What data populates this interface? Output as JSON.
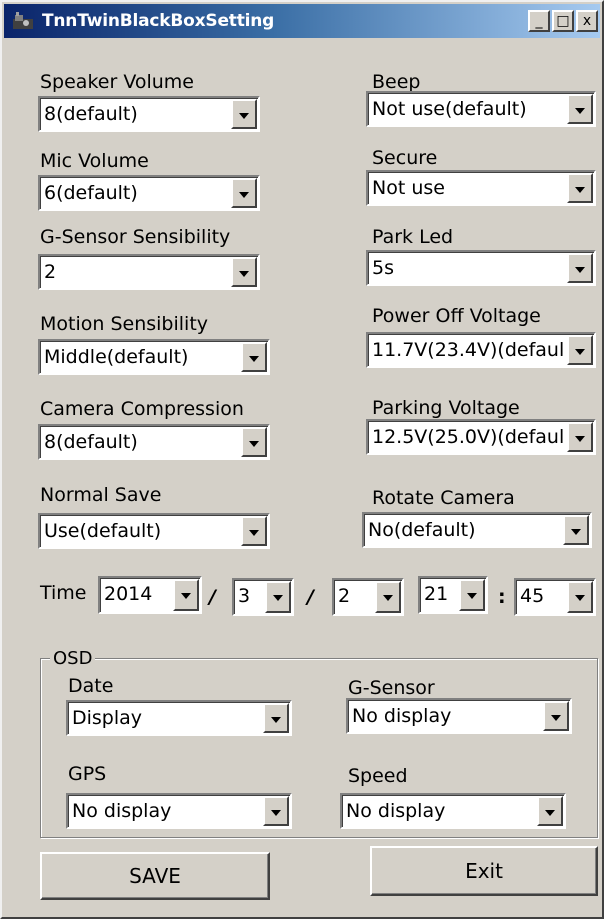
{
  "window": {
    "title": "TnnTwinBlackBoxSetting",
    "controls": [
      "_",
      "□",
      "x"
    ]
  },
  "left_settings": [
    {
      "label": "Speaker Volume",
      "value": "8(default)"
    },
    {
      "label": "Mic Volume",
      "value": "6(default)"
    },
    {
      "label": "G-Sensor Sensibility",
      "value": "2"
    },
    {
      "label": "Motion Sensibility",
      "value": "Middle(default)"
    },
    {
      "label": "Camera Compression",
      "value": "8(default)"
    },
    {
      "label": "Normal Save",
      "value": "Use(default)"
    }
  ],
  "right_settings": [
    {
      "label": "Beep",
      "value": "Not use(default)"
    },
    {
      "label": "Secure",
      "value": "Not use"
    },
    {
      "label": "Park Led",
      "value": "5s"
    },
    {
      "label": "Power Off Voltage",
      "value": "11.7V(23.4V)(defaul"
    },
    {
      "label": "Parking Voltage",
      "value": "12.5V(25.0V)(defaul"
    },
    {
      "label": "Rotate Camera",
      "value": "No(default)"
    }
  ],
  "time": {
    "label": "Time",
    "year": "2014",
    "month": "3",
    "day": "2",
    "hour": "21",
    "minute": "45",
    "date_sep": "/",
    "time_sep": ":"
  },
  "osd": {
    "legend": "OSD",
    "date": {
      "label": "Date",
      "value": "Display"
    },
    "gsensor": {
      "label": "G-Sensor",
      "value": "No display"
    },
    "gps": {
      "label": "GPS",
      "value": "No display"
    },
    "speed": {
      "label": "Speed",
      "value": "No display"
    }
  },
  "buttons": {
    "save": "SAVE",
    "exit": "Exit"
  }
}
